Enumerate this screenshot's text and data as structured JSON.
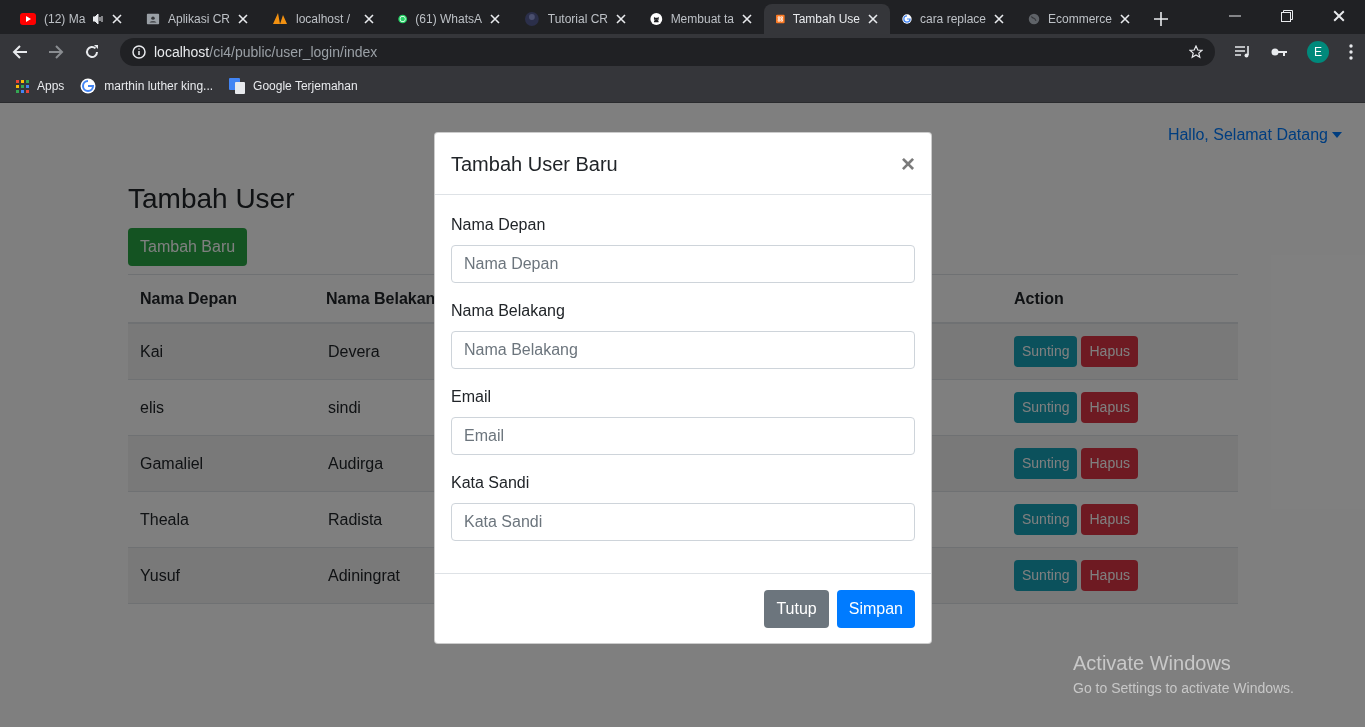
{
  "browser": {
    "tabs": [
      {
        "title": "(12) Ma",
        "selected": false,
        "audible": true
      },
      {
        "title": "Aplikasi CR",
        "selected": false,
        "audible": false
      },
      {
        "title": "localhost / ",
        "selected": false,
        "audible": false
      },
      {
        "title": "(61) WhatsA",
        "selected": false,
        "audible": false
      },
      {
        "title": "Tutorial CR",
        "selected": false,
        "audible": false
      },
      {
        "title": "Membuat ta",
        "selected": false,
        "audible": false
      },
      {
        "title": "Tambah Use",
        "selected": true,
        "audible": false
      },
      {
        "title": "cara replace",
        "selected": false,
        "audible": false
      },
      {
        "title": "Ecommerce",
        "selected": false,
        "audible": false
      }
    ],
    "address": {
      "host": "localhost",
      "path": "/ci4/public/user_login/index"
    },
    "profile": "E",
    "bookmarks": [
      "Apps",
      "marthin luther king...",
      "Google Terjemahan"
    ]
  },
  "page": {
    "greeting": "Hallo, Selamat Datang",
    "heading": "Tambah User",
    "add_button": "Tambah Baru",
    "table": {
      "columns": [
        "Nama Depan",
        "Nama Belakan",
        "Action"
      ],
      "rows": [
        {
          "first": "Kai",
          "last": "Devera",
          "actions": [
            "Sunting",
            "Hapus"
          ]
        },
        {
          "first": "elis",
          "last": "sindi",
          "actions": [
            "Sunting",
            "Hapus"
          ]
        },
        {
          "first": "Gamaliel",
          "last": "Audirga",
          "actions": [
            "Sunting",
            "Hapus"
          ]
        },
        {
          "first": "Theala",
          "last": "Radista",
          "actions": [
            "Sunting",
            "Hapus"
          ]
        },
        {
          "first": "Yusuf",
          "last": "Adiningrat",
          "actions": [
            "Sunting",
            "Hapus"
          ]
        }
      ]
    }
  },
  "modal": {
    "title": "Tambah User Baru",
    "close": "×",
    "fields": [
      {
        "label": "Nama Depan",
        "placeholder": "Nama Depan"
      },
      {
        "label": "Nama Belakang",
        "placeholder": "Nama Belakang"
      },
      {
        "label": "Email",
        "placeholder": "Email"
      },
      {
        "label": "Kata Sandi",
        "placeholder": "Kata Sandi"
      }
    ],
    "buttons": [
      {
        "label": "Tutup",
        "kind": "secondary"
      },
      {
        "label": "Simpan",
        "kind": "primary"
      }
    ]
  },
  "os_notice": {
    "title": "Activate Windows",
    "subtitle": "Go to Settings to activate Windows."
  }
}
